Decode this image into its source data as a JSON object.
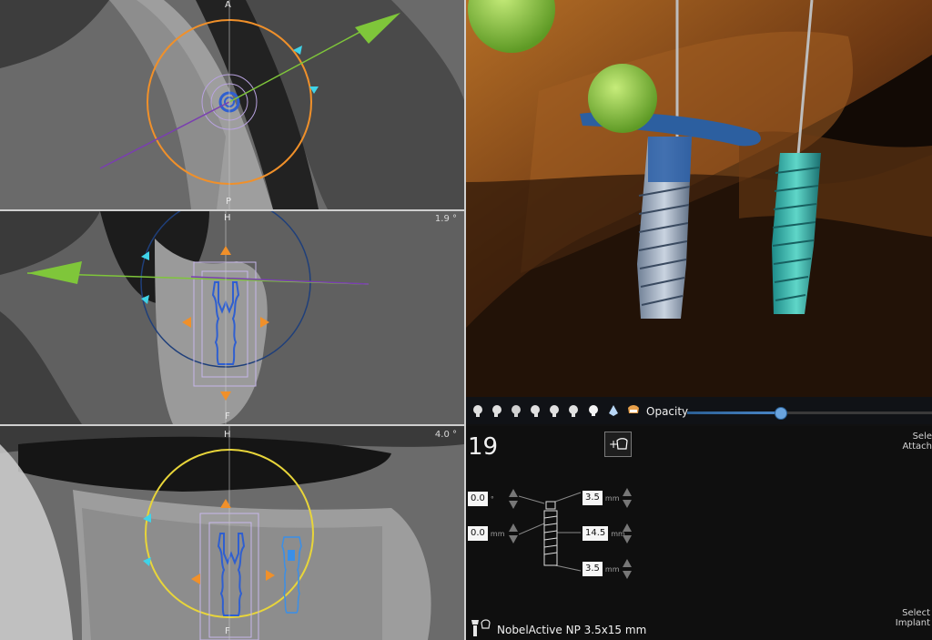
{
  "views": {
    "axial": {
      "label_top": "A",
      "label_bottom": "P"
    },
    "coronal": {
      "label_top": "H",
      "label_bottom": "F",
      "angle": "1.9 °"
    },
    "sagittal": {
      "label_top": "H",
      "label_bottom": "F",
      "angle": "4.0 °"
    }
  },
  "toolbar": {
    "icons": [
      "head-front-icon",
      "head-left-icon",
      "head-back-icon",
      "head-right-icon",
      "head-top-icon",
      "head-bottom-icon",
      "bone-icon",
      "soft-tissue-icon",
      "teeth-icon"
    ],
    "opacity_label": "Opacity",
    "opacity_value": 0.38
  },
  "implant_props": {
    "tooth_number": "19",
    "angle_value": "0.0",
    "angle_unit": "°",
    "offset_value": "0.0",
    "offset_unit": "mm",
    "top_diameter": "3.5",
    "length": "14.5",
    "bottom_diameter": "3.5",
    "mm_unit": "mm",
    "select_attachment_1": "Sele",
    "select_attachment_2": "Attach",
    "select_implant_1": "Select",
    "select_implant_2": "Implant",
    "implant_name": "NobelActive NP 3.5x15 mm"
  },
  "colors": {
    "accent_blue": "#2f5fd0",
    "green_arrow": "#7fc63a",
    "orange": "#f0902a",
    "cyan": "#3fd3e8",
    "yellow_ring": "#e8d53a",
    "navy_ring": "#1f3f7a"
  }
}
